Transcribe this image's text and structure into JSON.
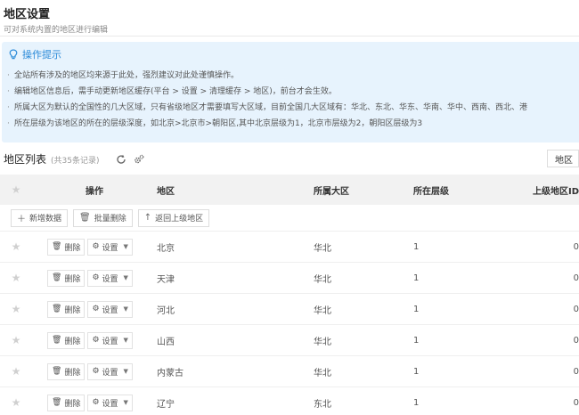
{
  "header": {
    "title": "地区设置",
    "subtitle": "可对系统内置的地区进行编辑"
  },
  "tips": {
    "title": "操作提示",
    "lines": [
      "全站所有涉及的地区均来源于此处，强烈建议对此处谨慎操作。",
      "编辑地区信息后，需手动更新地区缓存(平台 > 设置 > 清理缓存 > 地区)，前台才会生效。",
      "所属大区为默认的全国性的几大区域，只有省级地区才需要填写大区域，目前全国几大区域有：华北、东北、华东、华南、华中、西南、西北、港",
      "所在层级为该地区的所在的层级深度，如北京>北京市>朝阳区,其中北京层级为1，北京市层级为2，朝阳区层级为3"
    ]
  },
  "list": {
    "title": "地区列表",
    "count": "(共35条记录)",
    "right_button": "地区"
  },
  "table": {
    "columns": {
      "ops": "操作",
      "name": "地区",
      "bigarea": "所属大区",
      "level": "所在层级",
      "parent": "上级地区ID"
    },
    "toolbar": {
      "add": "新增数据",
      "batch_delete": "批量删除",
      "back": "返回上级地区"
    },
    "row_actions": {
      "delete": "删除",
      "settings": "设置"
    },
    "rows": [
      {
        "name": "北京",
        "bigarea": "华北",
        "level": "1",
        "parent": "0"
      },
      {
        "name": "天津",
        "bigarea": "华北",
        "level": "1",
        "parent": "0"
      },
      {
        "name": "河北",
        "bigarea": "华北",
        "level": "1",
        "parent": "0"
      },
      {
        "name": "山西",
        "bigarea": "华北",
        "level": "1",
        "parent": "0"
      },
      {
        "name": "内蒙古",
        "bigarea": "华北",
        "level": "1",
        "parent": "0"
      },
      {
        "name": "辽宁",
        "bigarea": "东北",
        "level": "1",
        "parent": "0"
      }
    ]
  }
}
